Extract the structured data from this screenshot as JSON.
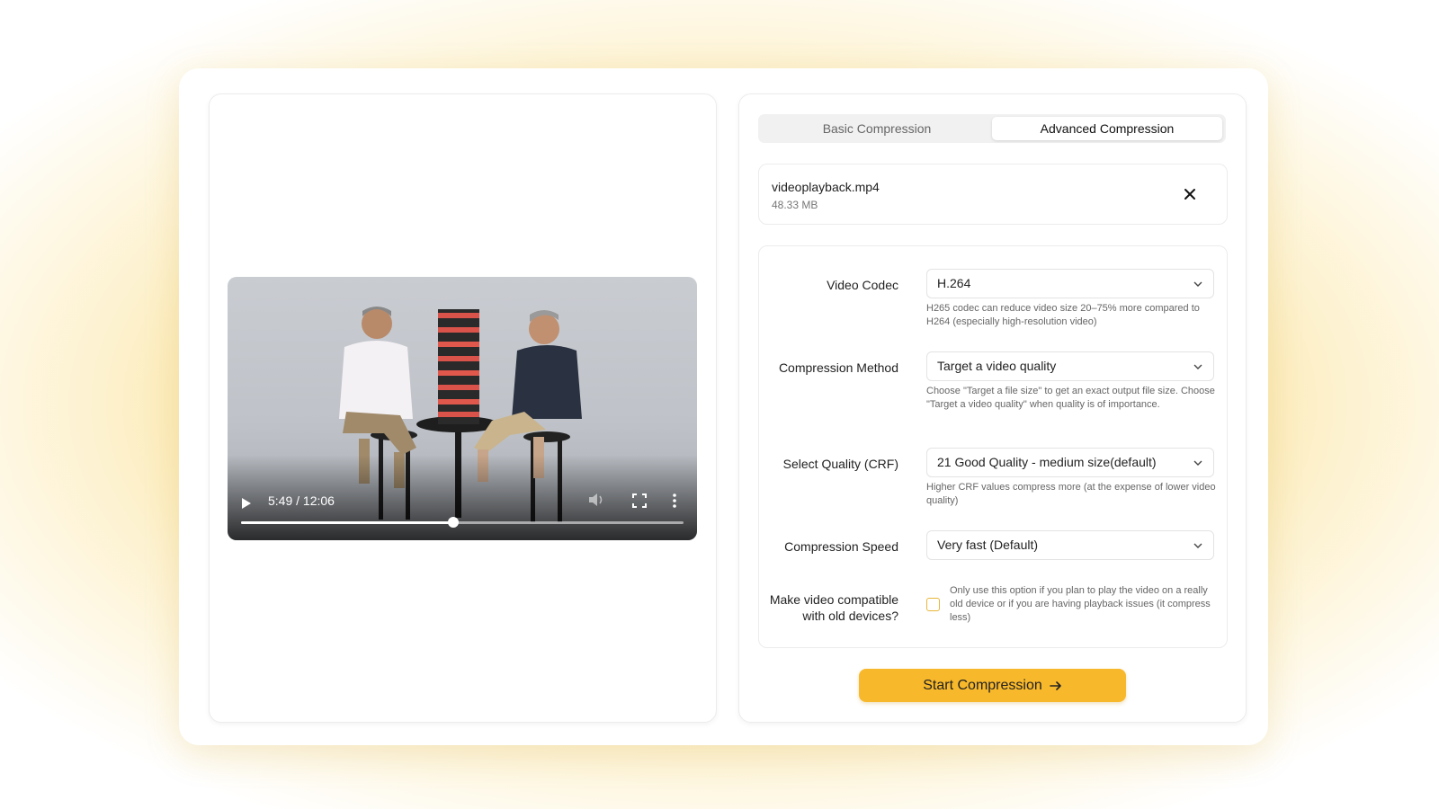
{
  "player": {
    "time": "5:49 / 12:06",
    "progress": 0.48
  },
  "tabs": {
    "basic": "Basic Compression",
    "advanced": "Advanced Compression"
  },
  "file": {
    "name": "videoplayback.mp4",
    "size": "48.33 MB"
  },
  "settings": {
    "video_codec": {
      "label": "Video Codec",
      "value": "H.264",
      "help": "H265 codec can reduce video size 20–75% more compared to H264 (especially high-resolution video)"
    },
    "compression_method": {
      "label": "Compression Method",
      "value": "Target a video quality",
      "help": "Choose \"Target a file size\" to get an exact output file size. Choose \"Target a video quality\" when quality is of importance."
    },
    "quality": {
      "label": "Select Quality (CRF)",
      "value": "21 Good Quality - medium size(default)",
      "help": "Higher CRF values compress more (at the expense of lower video quality)"
    },
    "speed": {
      "label": "Compression Speed",
      "value": "Very fast (Default)"
    },
    "compat": {
      "label_line1": "Make video compatible",
      "label_line2": "with old devices?",
      "help": "Only use this option if you plan to play the video on a really old device or if you are having playback issues (it compress less)",
      "checked": false
    }
  },
  "start_button": "Start Compression",
  "colors": {
    "accent": "#f8b82b",
    "checkbox_border": "#e8b73a"
  }
}
